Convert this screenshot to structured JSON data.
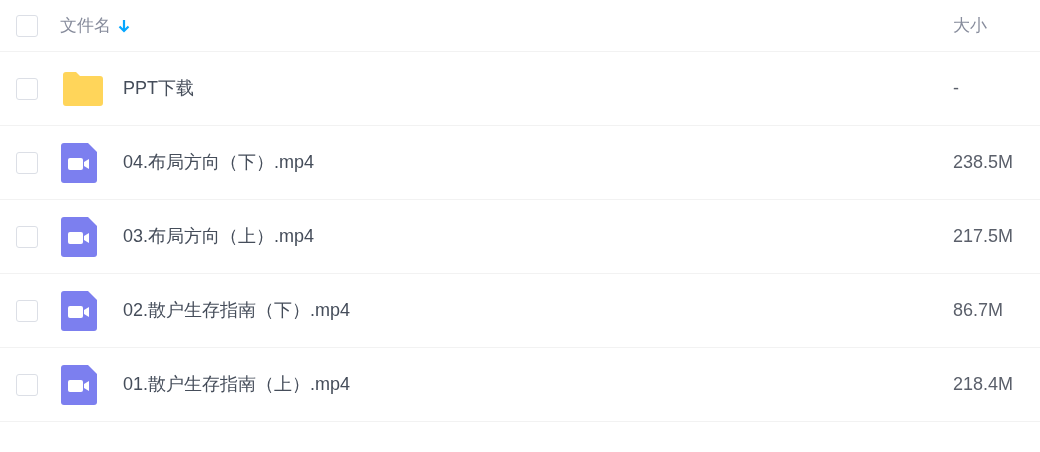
{
  "header": {
    "checked": false,
    "name_label": "文件名",
    "size_label": "大小"
  },
  "files": [
    {
      "kind": "folder",
      "name": "PPT下载",
      "size": "-",
      "checked": false
    },
    {
      "kind": "video",
      "name": "04.布局方向（下）.mp4",
      "size": "238.5M",
      "checked": false
    },
    {
      "kind": "video",
      "name": "03.布局方向（上）.mp4",
      "size": "217.5M",
      "checked": false
    },
    {
      "kind": "video",
      "name": "02.散户生存指南（下）.mp4",
      "size": "86.7M",
      "checked": false
    },
    {
      "kind": "video",
      "name": "01.散户生存指南（上）.mp4",
      "size": "218.4M",
      "checked": false
    }
  ]
}
